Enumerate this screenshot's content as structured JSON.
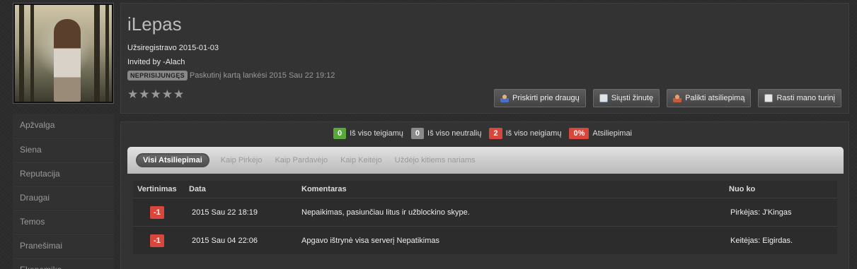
{
  "profile": {
    "username": "iLepas",
    "registered": "Užsiregistravo 2015-01-03",
    "invited_by": "Invited by -Alach",
    "status_badge": "NEPRISIJUNGĘS",
    "last_visit": "Paskutinį kartą lankėsi 2015 Sau 22 19:12",
    "rating_stars": 5,
    "rating_icon": "star-icon"
  },
  "actions": [
    {
      "label": "Priskirti prie draugų",
      "icon": "add-friend-icon"
    },
    {
      "label": "Siųsti žinutę",
      "icon": "message-icon"
    },
    {
      "label": "Palikti atsiliepimą",
      "icon": "feedback-icon"
    },
    {
      "label": "Rasti mano turinį",
      "icon": "find-content-icon"
    }
  ],
  "sidebar": {
    "items": [
      {
        "label": "Apžvalga"
      },
      {
        "label": "Siena"
      },
      {
        "label": "Reputacija"
      },
      {
        "label": "Draugai"
      },
      {
        "label": "Temos"
      },
      {
        "label": "Pranešimai"
      },
      {
        "label": "Ekonomika"
      }
    ]
  },
  "summary": {
    "positive_count": "0",
    "positive_label": "Iš viso teigiamų",
    "neutral_count": "0",
    "neutral_label": "Iš viso neutralių",
    "negative_count": "2",
    "negative_label": "Iš viso neigiamų",
    "percent": "0%",
    "percent_label": "Atsiliepimai",
    "colors": {
      "positive": "#58a83c",
      "neutral": "#8a8a8a",
      "negative": "#d9463b"
    }
  },
  "tabs": [
    {
      "label": "Visi Atsiliepimai",
      "active": true
    },
    {
      "label": "Kaip Pirkėjo",
      "active": false
    },
    {
      "label": "Kaip Pardavėjo",
      "active": false
    },
    {
      "label": "Kaip Keitėjo",
      "active": false
    },
    {
      "label": "Uždėjo kitiems nariams",
      "active": false
    }
  ],
  "table": {
    "headers": {
      "rating": "Vertinimas",
      "date": "Data",
      "comment": "Komentaras",
      "from": "Nuo ko"
    },
    "rows": [
      {
        "rating": "-1",
        "date": "2015 Sau 22 18:19",
        "comment": "Nepaikimas, pasiunčiau litus ir užblockino skype.",
        "from": "Pirkėjas: J'Kingas"
      },
      {
        "rating": "-1",
        "date": "2015 Sau 04 22:06",
        "comment": "Apgavo ištrynė visa serverį Nepatikimas",
        "from": "Keitėjas: Eigirdas."
      }
    ]
  }
}
